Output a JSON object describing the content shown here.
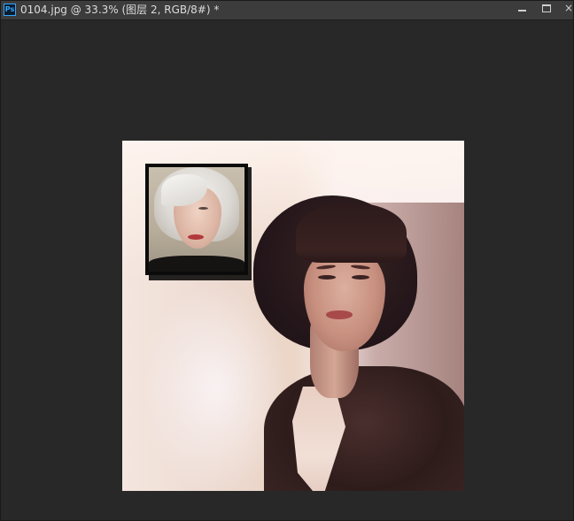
{
  "app": {
    "icon_label": "Ps",
    "icon": "photoshop-app-icon"
  },
  "document": {
    "tab_title": "0104.jpg @ 33.3% (图层 2, RGB/8#) *"
  },
  "window_controls": {
    "minimize_icon": "minimize-icon",
    "maximize_icon": "maximize-icon",
    "close_label": "×"
  },
  "colors": {
    "workspace_bg": "#282828",
    "titlebar_bg": "#3c3c3c",
    "ps_icon_accent": "#31a8ff"
  }
}
